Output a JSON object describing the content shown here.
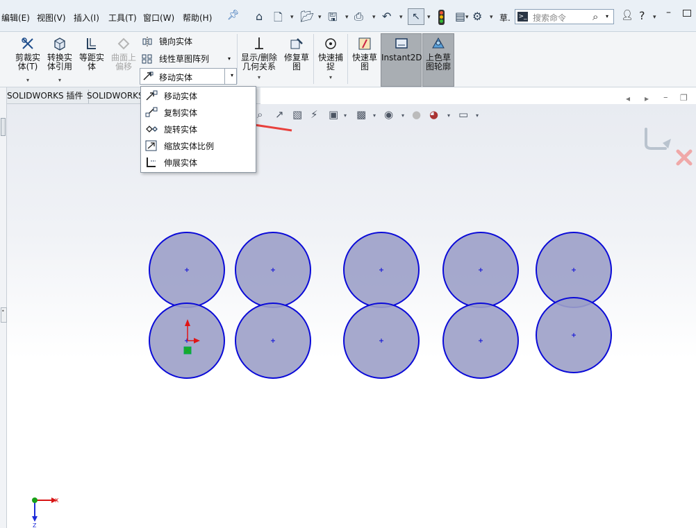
{
  "menubar": {
    "items": [
      {
        "label": "编辑(E)"
      },
      {
        "label": "视图(V)"
      },
      {
        "label": "插入(I)"
      },
      {
        "label": "工具(T)"
      },
      {
        "label": "窗口(W)"
      },
      {
        "label": "帮助(H)"
      }
    ],
    "truncated_label": "草.",
    "search_placeholder": "搜索命令"
  },
  "ribbon": {
    "trim": "剪裁实体(T)",
    "convert": "转换实体引用",
    "offset": "等距实体",
    "surface_offset": "曲面上偏移",
    "mirror": "镜向实体",
    "linear_pattern": "线性草图阵列",
    "move": "移动实体",
    "display_delete": "显示/删除几何关系",
    "repair": "修复草图",
    "quick_snap": "快速捕捉",
    "rapid_sketch": "快速草图",
    "instant2d": "Instant2D",
    "shaded": "上色草图轮廓"
  },
  "tabs": [
    {
      "label": "SOLIDWORKS 插件"
    },
    {
      "label": "SOLIDWORKS M"
    }
  ],
  "dropdown": {
    "items": [
      {
        "label": "移动实体"
      },
      {
        "label": "复制实体"
      },
      {
        "label": "旋转实体"
      },
      {
        "label": "缩放实体比例"
      },
      {
        "label": "伸展实体"
      }
    ]
  },
  "triad": {
    "x_label": "X",
    "z_label": "Z"
  },
  "colors": {
    "circle_stroke": "#0a0ad8",
    "circle_fill": "#9ca0c8",
    "arrow": "#e8403c"
  },
  "icons": [
    "home-icon",
    "new-doc-icon",
    "open-icon",
    "save-icon",
    "print-icon",
    "undo-icon",
    "select-icon",
    "traffic-light-icon",
    "gear-icon",
    "user-icon",
    "help-icon"
  ]
}
